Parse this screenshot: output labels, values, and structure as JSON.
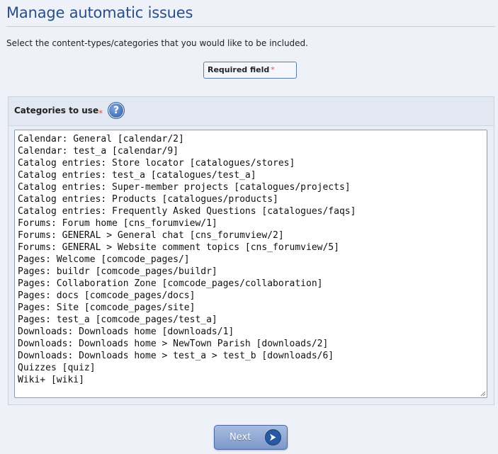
{
  "page": {
    "title": "Manage automatic issues",
    "intro": "Select the content-types/categories that you would like to be included."
  },
  "required_notice": {
    "label": "Required field",
    "star": "*"
  },
  "field": {
    "label": "Categories to use",
    "required_star": "*",
    "help_icon": "question-mark-icon",
    "help_glyph": "?",
    "options": [
      "Calendar: General [calendar/2]",
      "Calendar: test_a [calendar/9]",
      "Catalog entries: Store locator [catalogues/stores]",
      "Catalog entries: test_a [catalogues/test_a]",
      "Catalog entries: Super-member projects [catalogues/projects]",
      "Catalog entries: Products [catalogues/products]",
      "Catalog entries: Frequently Asked Questions [catalogues/faqs]",
      "Forums: Forum home [cns_forumview/1]",
      "Forums: GENERAL > General chat [cns_forumview/2]",
      "Forums: GENERAL > Website comment topics [cns_forumview/5]",
      "Pages: Welcome [comcode_pages/]",
      "Pages: buildr [comcode_pages/buildr]",
      "Pages: Collaboration Zone [comcode_pages/collaboration]",
      "Pages: docs [comcode_pages/docs]",
      "Pages: Site [comcode_pages/site]",
      "Pages: test_a [comcode_pages/test_a]",
      "Downloads: Downloads home [downloads/1]",
      "Downloads: Downloads home > NewTown Parish [downloads/2]",
      "Downloads: Downloads home > test_a > test_b [downloads/6]",
      "Quizzes [quiz]",
      "Wiki+ [wiki]"
    ]
  },
  "actions": {
    "next_label": "Next",
    "next_icon": "arrow-right-icon"
  },
  "colors": {
    "title": "#2a4e85",
    "required_star": "#e0504a",
    "button_gradient_top": "#a7bce0",
    "button_gradient_bottom": "#7d98c9",
    "next_icon_bg": "#28589f"
  }
}
